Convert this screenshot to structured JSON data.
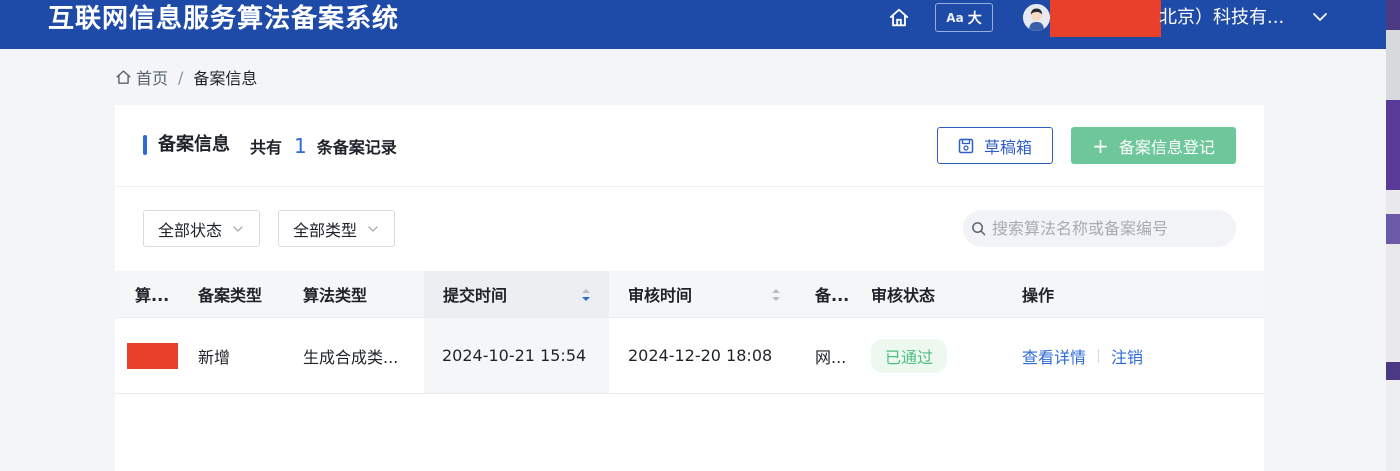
{
  "header": {
    "title": "互联网信息服务算法备案系统",
    "font_size_label_aa": "Aa",
    "font_size_label_big": "大",
    "user_name_visible": "北京）科技有...",
    "colors": {
      "primary": "#1f4ba8",
      "redact": "#e8402a"
    }
  },
  "breadcrumb": {
    "home": "首页",
    "separator": "/",
    "current": "备案信息"
  },
  "card": {
    "title": "备案信息",
    "count_prefix": "共有",
    "count": "1",
    "count_suffix": "条备案记录",
    "draft_button": "草稿箱",
    "register_button": "备案信息登记",
    "register_plus": "+",
    "colors": {
      "accent": "#2f6bd8",
      "success": "#6ec79a"
    }
  },
  "filters": {
    "status": "全部状态",
    "type": "全部类型",
    "search_placeholder": "搜索算法名称或备案编号"
  },
  "table": {
    "columns": [
      "算...",
      "备案类型",
      "算法类型",
      "提交时间",
      "审核时间",
      "备...",
      "审核状态",
      "操作"
    ],
    "rows": [
      {
        "filing_type": "新增",
        "algorithm_type": "生成合成类...",
        "submit_time": "2024-10-21 15:54",
        "review_time": "2024-12-20 18:08",
        "col6": "网...",
        "status": "已通过",
        "op_view": "查看详情",
        "op_cancel": "注销"
      }
    ]
  }
}
